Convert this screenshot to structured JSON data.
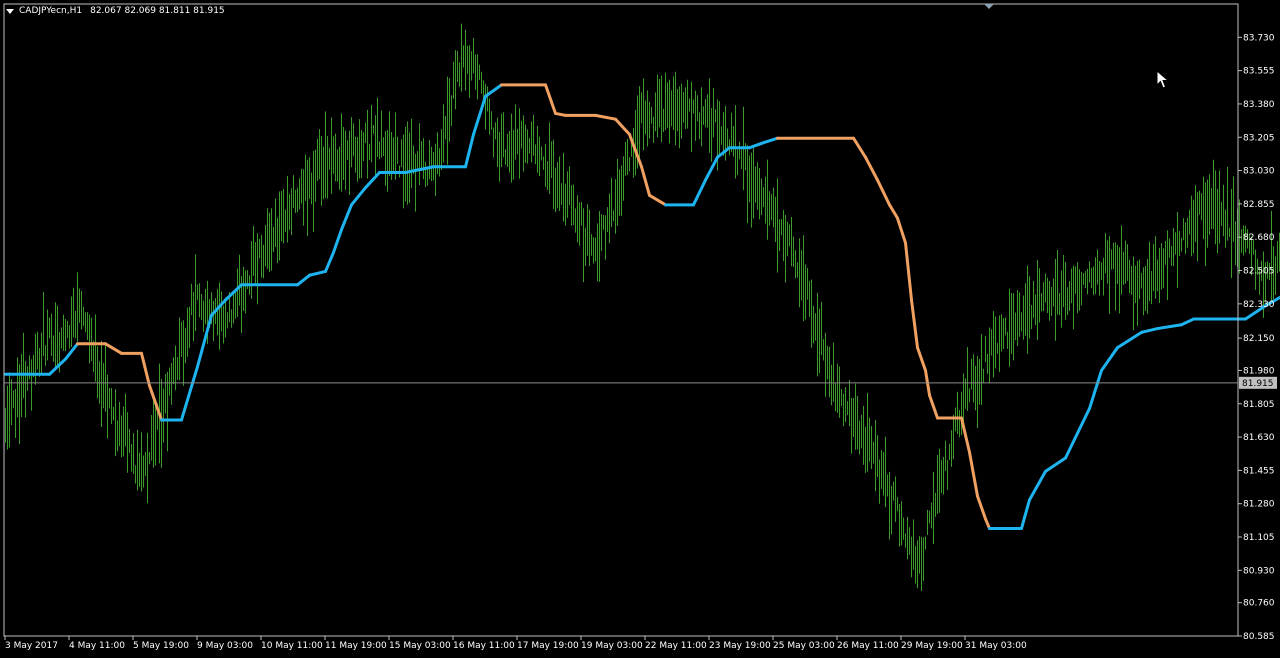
{
  "header": {
    "symbol": "CADJPYecn,H1",
    "ohlc": "82.067 82.069 81.811 81.915"
  },
  "colors": {
    "background": "#000000",
    "frame": "#c0c0c0",
    "candles": "#3c9a2a",
    "line_up": "#1eb4f0",
    "line_down": "#f0a060",
    "price_line": "#8c8c8c",
    "current_price_box": "#c0c0c0"
  },
  "icons": {
    "collapse": "triangle-down-icon",
    "cursor": "mouse-pointer-icon"
  },
  "chart_data": {
    "type": "line",
    "current_price": 81.915,
    "current_price_label": "81.915",
    "y_ticks": [
      "83.730",
      "83.555",
      "83.380",
      "83.205",
      "83.030",
      "82.855",
      "82.680",
      "82.505",
      "82.330",
      "82.150",
      "81.980",
      "81.805",
      "81.630",
      "81.455",
      "81.280",
      "81.105",
      "80.930",
      "80.760",
      "80.585"
    ],
    "x_ticks": [
      "3 May 2017",
      "4 May 11:00",
      "5 May 19:00",
      "9 May 03:00",
      "10 May 11:00",
      "11 May 19:00",
      "15 May 03:00",
      "16 May 11:00",
      "17 May 19:00",
      "19 May 03:00",
      "22 May 11:00",
      "23 May 19:00",
      "25 May 03:00",
      "26 May 11:00",
      "29 May 19:00",
      "31 May 03:00"
    ],
    "ylim": [
      80.585,
      83.905
    ],
    "n_bars": 492,
    "price_path": [
      [
        0,
        81.75
      ],
      [
        10,
        81.95
      ],
      [
        20,
        82.12
      ],
      [
        30,
        82.16
      ],
      [
        38,
        82.35
      ],
      [
        45,
        82.05
      ],
      [
        55,
        81.7
      ],
      [
        60,
        81.65
      ],
      [
        66,
        81.45
      ],
      [
        74,
        81.6
      ],
      [
        84,
        81.95
      ],
      [
        95,
        82.35
      ],
      [
        110,
        82.2
      ],
      [
        125,
        82.55
      ],
      [
        140,
        82.8
      ],
      [
        160,
        83.05
      ],
      [
        185,
        83.2
      ],
      [
        200,
        83.05
      ],
      [
        215,
        83.05
      ],
      [
        228,
        83.6
      ],
      [
        236,
        83.55
      ],
      [
        246,
        83.15
      ],
      [
        262,
        83.2
      ],
      [
        280,
        82.9
      ],
      [
        294,
        82.6
      ],
      [
        305,
        82.85
      ],
      [
        318,
        83.3
      ],
      [
        335,
        83.35
      ],
      [
        350,
        83.3
      ],
      [
        362,
        83.2
      ],
      [
        378,
        82.9
      ],
      [
        398,
        82.5
      ],
      [
        412,
        81.95
      ],
      [
        425,
        81.7
      ],
      [
        440,
        81.4
      ],
      [
        455,
        80.95
      ],
      [
        466,
        81.3
      ],
      [
        480,
        81.85
      ],
      [
        495,
        82.1
      ],
      [
        518,
        82.35
      ],
      [
        542,
        82.45
      ],
      [
        556,
        82.55
      ],
      [
        566,
        82.4
      ],
      [
        580,
        82.55
      ],
      [
        596,
        82.8
      ],
      [
        604,
        82.85
      ],
      [
        618,
        82.7
      ],
      [
        628,
        82.5
      ],
      [
        640,
        82.6
      ],
      [
        650,
        82.75
      ],
      [
        664,
        83.05
      ],
      [
        680,
        83.2
      ],
      [
        696,
        83.15
      ],
      [
        712,
        82.85
      ],
      [
        724,
        82.6
      ],
      [
        742,
        82.7
      ],
      [
        760,
        82.75
      ],
      [
        778,
        82.7
      ],
      [
        790,
        82.45
      ],
      [
        808,
        82.3
      ],
      [
        826,
        82.4
      ],
      [
        842,
        82.45
      ],
      [
        858,
        82.35
      ],
      [
        868,
        82.25
      ],
      [
        874,
        82.1
      ],
      [
        878,
        81.85
      ]
    ],
    "trend_line": [
      [
        0,
        81.96,
        "down"
      ],
      [
        22,
        81.96,
        "up"
      ],
      [
        30,
        82.04,
        "up"
      ],
      [
        36,
        82.12,
        "up"
      ],
      [
        50,
        82.12,
        "down"
      ],
      [
        58,
        82.07,
        "down"
      ],
      [
        68,
        82.07,
        "down"
      ],
      [
        72,
        81.9,
        "down"
      ],
      [
        78,
        81.72,
        "down"
      ],
      [
        88,
        81.72,
        "up"
      ],
      [
        96,
        82.0,
        "up"
      ],
      [
        103,
        82.27,
        "up"
      ],
      [
        110,
        82.35,
        "up"
      ],
      [
        118,
        82.43,
        "up"
      ],
      [
        146,
        82.43,
        "up"
      ],
      [
        152,
        82.48,
        "up"
      ],
      [
        160,
        82.5,
        "up"
      ],
      [
        164,
        82.6,
        "up"
      ],
      [
        168,
        82.72,
        "up"
      ],
      [
        173,
        82.85,
        "up"
      ],
      [
        180,
        82.94,
        "up"
      ],
      [
        187,
        83.02,
        "up"
      ],
      [
        200,
        83.02,
        "up"
      ],
      [
        214,
        83.05,
        "up"
      ],
      [
        230,
        83.05,
        "up"
      ],
      [
        234,
        83.22,
        "up"
      ],
      [
        240,
        83.42,
        "up"
      ],
      [
        248,
        83.48,
        "up"
      ],
      [
        270,
        83.48,
        "down"
      ],
      [
        275,
        83.33,
        "down"
      ],
      [
        280,
        83.32,
        "down"
      ],
      [
        295,
        83.32,
        "down"
      ],
      [
        305,
        83.3,
        "down"
      ],
      [
        312,
        83.22,
        "down"
      ],
      [
        318,
        83.05,
        "down"
      ],
      [
        322,
        82.9,
        "down"
      ],
      [
        330,
        82.85,
        "down"
      ],
      [
        344,
        82.85,
        "up"
      ],
      [
        350,
        82.98,
        "up"
      ],
      [
        356,
        83.1,
        "up"
      ],
      [
        362,
        83.15,
        "up"
      ],
      [
        372,
        83.15,
        "up"
      ],
      [
        380,
        83.18,
        "up"
      ],
      [
        386,
        83.2,
        "up"
      ],
      [
        424,
        83.2,
        "down"
      ],
      [
        430,
        83.1,
        "down"
      ],
      [
        436,
        82.98,
        "down"
      ],
      [
        442,
        82.85,
        "down"
      ],
      [
        446,
        82.78,
        "down"
      ],
      [
        450,
        82.65,
        "down"
      ],
      [
        453,
        82.35,
        "down"
      ],
      [
        456,
        82.1,
        "down"
      ],
      [
        460,
        81.98,
        "down"
      ],
      [
        462,
        81.85,
        "down"
      ],
      [
        466,
        81.73,
        "down"
      ],
      [
        478,
        81.73,
        "down"
      ],
      [
        482,
        81.55,
        "down"
      ],
      [
        486,
        81.32,
        "down"
      ],
      [
        490,
        81.2,
        "down"
      ],
      [
        492,
        81.15,
        "down"
      ],
      [
        508,
        81.15,
        "up"
      ],
      [
        512,
        81.3,
        "up"
      ],
      [
        520,
        81.45,
        "up"
      ],
      [
        530,
        81.52,
        "up"
      ],
      [
        536,
        81.65,
        "up"
      ],
      [
        542,
        81.78,
        "up"
      ],
      [
        548,
        81.98,
        "up"
      ],
      [
        556,
        82.1,
        "up"
      ],
      [
        568,
        82.18,
        "up"
      ],
      [
        576,
        82.2,
        "up"
      ],
      [
        588,
        82.22,
        "up"
      ],
      [
        594,
        82.25,
        "up"
      ],
      [
        620,
        82.25,
        "up"
      ],
      [
        630,
        82.32,
        "up"
      ],
      [
        640,
        82.38,
        "up"
      ],
      [
        650,
        82.45,
        "up"
      ],
      [
        670,
        82.5,
        "up"
      ],
      [
        676,
        82.55,
        "up"
      ],
      [
        680,
        82.8,
        "up"
      ],
      [
        686,
        83.0,
        "up"
      ],
      [
        696,
        83.05,
        "up"
      ],
      [
        706,
        83.1,
        "up"
      ],
      [
        714,
        83.2,
        "up"
      ],
      [
        736,
        83.2,
        "down"
      ],
      [
        742,
        83.1,
        "down"
      ],
      [
        746,
        82.95,
        "down"
      ],
      [
        750,
        82.85,
        "down"
      ],
      [
        756,
        82.72,
        "down"
      ],
      [
        822,
        82.72,
        "down"
      ],
      [
        826,
        82.62,
        "down"
      ],
      [
        832,
        82.55,
        "down"
      ],
      [
        884,
        82.55,
        "down"
      ],
      [
        886,
        82.45,
        "down"
      ],
      [
        888,
        82.37,
        "down"
      ]
    ],
    "seed": 17
  }
}
